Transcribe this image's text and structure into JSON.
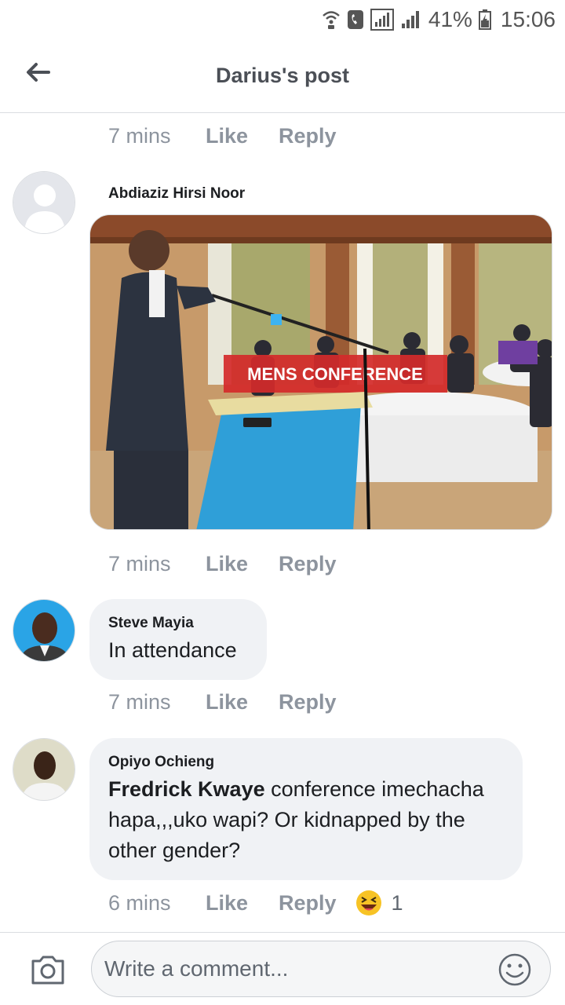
{
  "status_bar": {
    "battery": "41%",
    "time": "15:06",
    "icons": [
      "wifi-calling-icon",
      "phone-icon",
      "signal-box-icon",
      "signal-bars-icon",
      "battery-icon"
    ]
  },
  "header": {
    "title": "Darius's post",
    "back_icon": "back-arrow-icon"
  },
  "comments": [
    {
      "meta": {
        "time": "7 mins",
        "like": "Like",
        "reply": "Reply"
      }
    },
    {
      "author": "Abdiaziz Hirsi Noor",
      "photo_banner": "MENS CONFERENCE",
      "meta": {
        "time": "7 mins",
        "like": "Like",
        "reply": "Reply"
      }
    },
    {
      "author": "Steve Mayia",
      "text": "In attendance",
      "meta": {
        "time": "7 mins",
        "like": "Like",
        "reply": "Reply"
      }
    },
    {
      "author": "Opiyo Ochieng",
      "mention": "Fredrick Kwaye",
      "text": " conference imechacha hapa,,,uko wapi? Or kidnapped by the other gender?",
      "meta": {
        "time": "6 mins",
        "like": "Like",
        "reply": "Reply",
        "reaction_icon": "laughing-emoji-icon",
        "reaction_count": "1"
      }
    }
  ],
  "composer": {
    "placeholder": "Write a comment...",
    "camera_icon": "camera-icon",
    "emoji_icon": "smiley-icon"
  },
  "colors": {
    "meta_text": "#8d949e",
    "bubble_bg": "#f0f2f5",
    "divider": "#dadde1"
  }
}
